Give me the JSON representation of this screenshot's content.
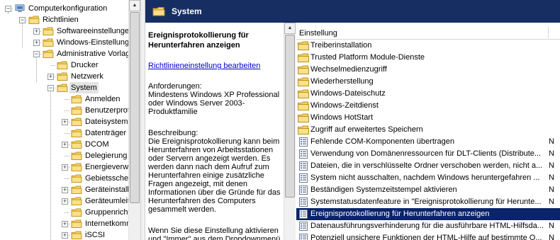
{
  "tree": {
    "items": [
      {
        "label": "Computerkonfiguration",
        "expander": "minus",
        "icon": "computer-icon"
      },
      {
        "label": "Richtlinien",
        "expander": "minus",
        "icon": "folder-icon"
      },
      {
        "label": "Softwareeinstellungen",
        "expander": "plus",
        "icon": "folder-icon"
      },
      {
        "label": "Windows-Einstellungen",
        "expander": "plus",
        "icon": "folder-icon"
      },
      {
        "label": "Administrative Vorlagen",
        "expander": "minus",
        "icon": "folder-icon"
      },
      {
        "label": "Drucker",
        "expander": "none",
        "icon": "folder-icon"
      },
      {
        "label": "Netzwerk",
        "expander": "plus",
        "icon": "folder-icon"
      },
      {
        "label": "System",
        "expander": "minus",
        "icon": "folder-icon",
        "selected": true
      },
      {
        "label": "Anmelden",
        "expander": "none",
        "icon": "folder-icon"
      },
      {
        "label": "Benutzerprofile",
        "expander": "none",
        "icon": "folder-icon"
      },
      {
        "label": "Dateisystem",
        "expander": "plus",
        "icon": "folder-icon"
      },
      {
        "label": "Datenträger",
        "expander": "none",
        "icon": "folder-icon"
      },
      {
        "label": "DCOM",
        "expander": "plus",
        "icon": "folder-icon"
      },
      {
        "label": "Delegierung",
        "expander": "none",
        "icon": "folder-icon"
      },
      {
        "label": "Energieverwaltung",
        "expander": "plus",
        "icon": "folder-icon"
      },
      {
        "label": "Gebietsschema",
        "expander": "none",
        "icon": "folder-icon"
      },
      {
        "label": "Geräteinstallation",
        "expander": "plus",
        "icon": "folder-icon"
      },
      {
        "label": "Geräteumleitung",
        "expander": "plus",
        "icon": "folder-icon"
      },
      {
        "label": "Gruppenrichtlinie",
        "expander": "none",
        "icon": "folder-icon"
      },
      {
        "label": "Internetkommunikation",
        "expander": "plus",
        "icon": "folder-icon"
      },
      {
        "label": "iSCSI",
        "expander": "plus",
        "icon": "folder-icon"
      }
    ]
  },
  "header": {
    "title": "System",
    "icon": "folder-icon"
  },
  "description": {
    "title": "Ereignisprotokollierung für Herunterfahren anzeigen",
    "edit_link": "Richtlinieneinstellung bearbeiten",
    "requirements_label": "Anforderungen:",
    "requirements_text": "Mindestens Windows XP Professional oder Windows Server 2003-Produktfamilie",
    "description_label": "Beschreibung:",
    "description_text": "Die Ereignisprotokollierung kann beim Herunterfahren von Arbeitsstationen oder Servern angezeigt werden. Es werden dann nach dem Aufruf zum Herunterfahren einige zusätzliche Fragen angezeigt, mit denen Informationen über die Gründe für das Herunterfahren des Computers gesammelt werden.",
    "more_text": "Wenn Sie diese Einstellung aktivieren und \"Immer\" aus dem Dropdownmenü"
  },
  "list": {
    "column_header": "Einstellung",
    "rows": [
      {
        "label": "Treiberinstallation",
        "icon": "folder-icon",
        "state": ""
      },
      {
        "label": "Trusted Platform Module-Dienste",
        "icon": "folder-icon",
        "state": ""
      },
      {
        "label": "Wechselmedienzugriff",
        "icon": "folder-icon",
        "state": ""
      },
      {
        "label": "Wiederherstellung",
        "icon": "folder-icon",
        "state": ""
      },
      {
        "label": "Windows-Dateischutz",
        "icon": "folder-icon",
        "state": ""
      },
      {
        "label": "Windows-Zeitdienst",
        "icon": "folder-icon",
        "state": ""
      },
      {
        "label": "Windows HotStart",
        "icon": "folder-icon",
        "state": ""
      },
      {
        "label": "Zugriff auf erweitertes Speichern",
        "icon": "folder-icon",
        "state": ""
      },
      {
        "label": "Fehlende COM-Komponenten übertragen",
        "icon": "policy-icon",
        "state": "N"
      },
      {
        "label": "Verwendung von Domänenressourcen für DLT-Clients (Distribute...",
        "icon": "policy-icon",
        "state": "N"
      },
      {
        "label": "Dateien, die in verschlüsselte Ordner verschoben werden, nicht a...",
        "icon": "policy-icon",
        "state": "N"
      },
      {
        "label": "System nicht ausschalten, nachdem Windows heruntergefahren ...",
        "icon": "policy-icon",
        "state": "N"
      },
      {
        "label": "Beständigen Systemzeitstempel aktivieren",
        "icon": "policy-icon",
        "state": "N"
      },
      {
        "label": "Systemstatusdatenfeature in \"Ereignisprotokollierung für Herunte...",
        "icon": "policy-icon",
        "state": "N"
      },
      {
        "label": "Ereignisprotokollierung für Herunterfahren anzeigen",
        "icon": "policy-icon",
        "state": "",
        "selected": true
      },
      {
        "label": "Datenausführungsverhinderung für die ausführbare HTML-Hilfsda...",
        "icon": "policy-icon",
        "state": "N"
      },
      {
        "label": "Potenziell unsichere Funktionen der HTML-Hilfe auf bestimmte O...",
        "icon": "policy-icon",
        "state": "N"
      }
    ]
  },
  "colors": {
    "header_bg": "#162e62",
    "selection_bg": "#0a246a",
    "folder_yellow": "#f7d25c",
    "link": "#0000cc"
  }
}
